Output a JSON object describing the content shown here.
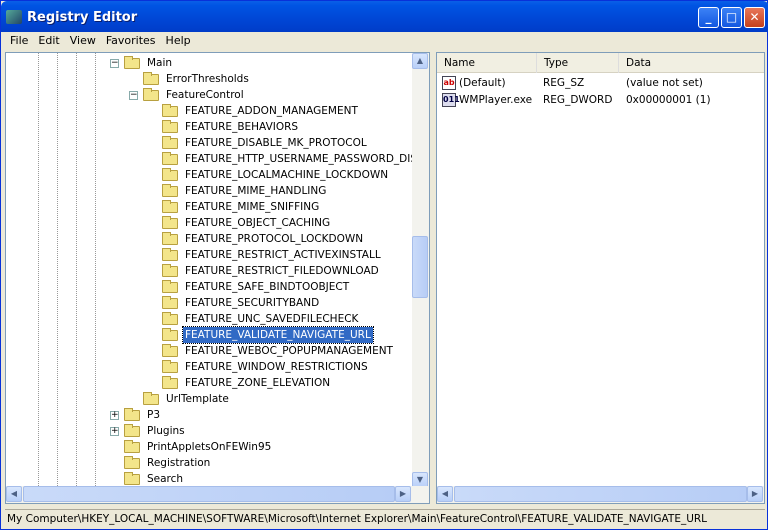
{
  "window": {
    "title": "Registry Editor",
    "min": "_",
    "max": "□",
    "close": "✕"
  },
  "menu": [
    "File",
    "Edit",
    "View",
    "Favorites",
    "Help"
  ],
  "tree": [
    {
      "label": "Main",
      "level": 1,
      "exp": "−"
    },
    {
      "label": "ErrorThresholds",
      "level": 2
    },
    {
      "label": "FeatureControl",
      "level": 2,
      "exp": "−"
    },
    {
      "label": "FEATURE_ADDON_MANAGEMENT",
      "level": 3
    },
    {
      "label": "FEATURE_BEHAVIORS",
      "level": 3
    },
    {
      "label": "FEATURE_DISABLE_MK_PROTOCOL",
      "level": 3
    },
    {
      "label": "FEATURE_HTTP_USERNAME_PASSWORD_DISABLE",
      "level": 3
    },
    {
      "label": "FEATURE_LOCALMACHINE_LOCKDOWN",
      "level": 3
    },
    {
      "label": "FEATURE_MIME_HANDLING",
      "level": 3
    },
    {
      "label": "FEATURE_MIME_SNIFFING",
      "level": 3
    },
    {
      "label": "FEATURE_OBJECT_CACHING",
      "level": 3
    },
    {
      "label": "FEATURE_PROTOCOL_LOCKDOWN",
      "level": 3
    },
    {
      "label": "FEATURE_RESTRICT_ACTIVEXINSTALL",
      "level": 3
    },
    {
      "label": "FEATURE_RESTRICT_FILEDOWNLOAD",
      "level": 3
    },
    {
      "label": "FEATURE_SAFE_BINDTOOBJECT",
      "level": 3
    },
    {
      "label": "FEATURE_SECURITYBAND",
      "level": 3
    },
    {
      "label": "FEATURE_UNC_SAVEDFILECHECK",
      "level": 3
    },
    {
      "label": "FEATURE_VALIDATE_NAVIGATE_URL",
      "level": 3,
      "selected": true
    },
    {
      "label": "FEATURE_WEBOC_POPUPMANAGEMENT",
      "level": 3
    },
    {
      "label": "FEATURE_WINDOW_RESTRICTIONS",
      "level": 3
    },
    {
      "label": "FEATURE_ZONE_ELEVATION",
      "level": 3
    },
    {
      "label": "UrlTemplate",
      "level": 2
    },
    {
      "label": "P3",
      "level": 1,
      "exp": "+"
    },
    {
      "label": "Plugins",
      "level": 1,
      "exp": "+"
    },
    {
      "label": "PrintAppletsOnFEWin95",
      "level": 1
    },
    {
      "label": "Registration",
      "level": 1
    },
    {
      "label": "Search",
      "level": 1
    }
  ],
  "list": {
    "headers": [
      "Name",
      "Type",
      "Data"
    ],
    "rows": [
      {
        "icon": "string-value-icon",
        "glyph": "ab",
        "name": "(Default)",
        "type": "REG_SZ",
        "data": "(value not set)"
      },
      {
        "icon": "binary-value-icon",
        "glyph": "011",
        "name": "WMPlayer.exe",
        "type": "REG_DWORD",
        "data": "0x00000001 (1)"
      }
    ]
  },
  "status": "My Computer\\HKEY_LOCAL_MACHINE\\SOFTWARE\\Microsoft\\Internet Explorer\\Main\\FeatureControl\\FEATURE_VALIDATE_NAVIGATE_URL"
}
